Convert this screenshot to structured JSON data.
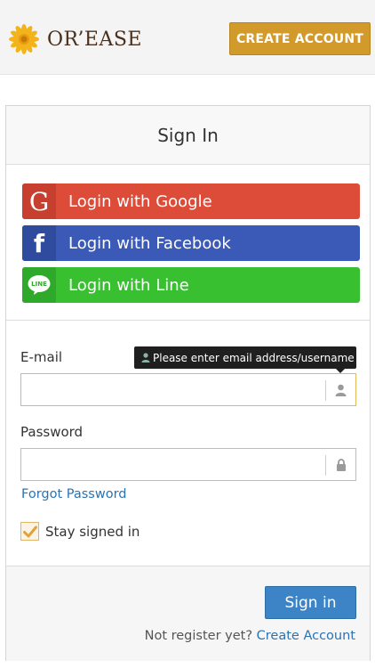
{
  "header": {
    "logo_text": "OR’EASE",
    "create_account_label": "CREATE ACCOUNT"
  },
  "card": {
    "title": "Sign In",
    "social": {
      "google_icon": "G",
      "google_label": "Login with Google",
      "facebook_icon": "f",
      "facebook_label": "Login with Facebook",
      "line_icon": "LINE",
      "line_label": "Login with Line"
    },
    "email": {
      "label": "E-mail",
      "value": "",
      "tooltip": "Please enter email address/username"
    },
    "password": {
      "label": "Password",
      "value": ""
    },
    "forgot_label": "Forgot Password",
    "stay_signed_in_label": "Stay signed in",
    "stay_signed_in_checked": true,
    "signin_label": "Sign in",
    "register_prompt": "Not register yet?",
    "register_link": "Create Account"
  },
  "colors": {
    "google": "#dd4b39",
    "facebook": "#3b5ab8",
    "line": "#38c030",
    "create_account": "#d29a2a",
    "sign_in": "#3d84c6",
    "link": "#2a73b3"
  },
  "icons": {
    "logo": "sunflower-icon",
    "email_adornment": "user-icon",
    "password_adornment": "lock-icon",
    "checkbox": "checkmark-icon"
  }
}
